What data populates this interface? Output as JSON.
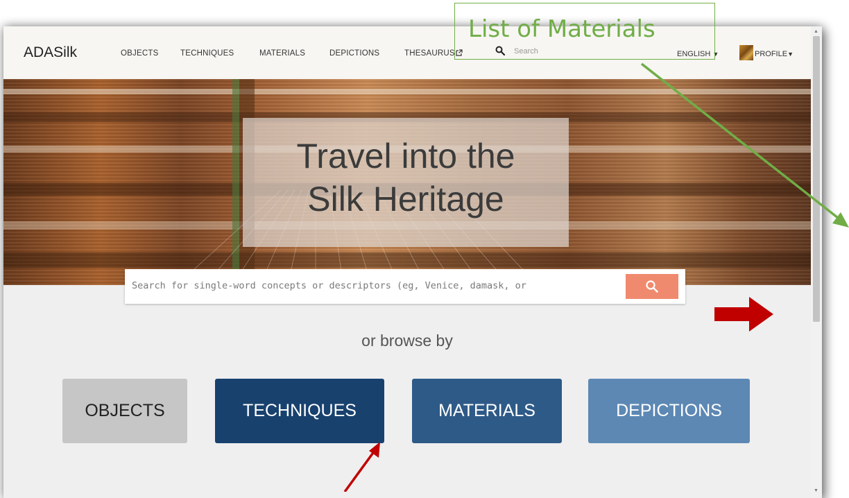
{
  "header": {
    "brand": "ADASilk",
    "nav": [
      "OBJECTS",
      "TECHNIQUES",
      "MATERIALS",
      "DEPICTIONS",
      "THESAURUS"
    ],
    "search_placeholder": "Search",
    "language": "ENGLISH",
    "profile": "PROFILE"
  },
  "hero": {
    "title_line1": "Travel into the",
    "title_line2": "Silk Heritage"
  },
  "main_search": {
    "placeholder": "Search for single-word concepts or descriptors (eg, Venice, damask, or"
  },
  "browse": {
    "label": "or browse by",
    "buttons": [
      {
        "label": "OBJECTS",
        "bg": "#c6c6c6",
        "fg": "#222222"
      },
      {
        "label": "TECHNIQUES",
        "bg": "#18416e",
        "fg": "#ffffff"
      },
      {
        "label": "MATERIALS",
        "bg": "#2e5a87",
        "fg": "#ffffff"
      },
      {
        "label": "DEPICTIONS",
        "bg": "#5d88b4",
        "fg": "#ffffff"
      }
    ]
  },
  "annotation": {
    "label": "List of Materials",
    "box_color": "#70ad47",
    "arrow_green": "#70ad47",
    "arrow_red": "#c00000"
  },
  "colors": {
    "search_button": "#f08a6e",
    "nav_bg": "#f7f6f2",
    "page_bg": "#efefef"
  },
  "icons": {
    "nav_search": "search-icon",
    "external_link": "external-link-icon",
    "main_search": "search-icon",
    "caret": "caret-down-icon"
  }
}
